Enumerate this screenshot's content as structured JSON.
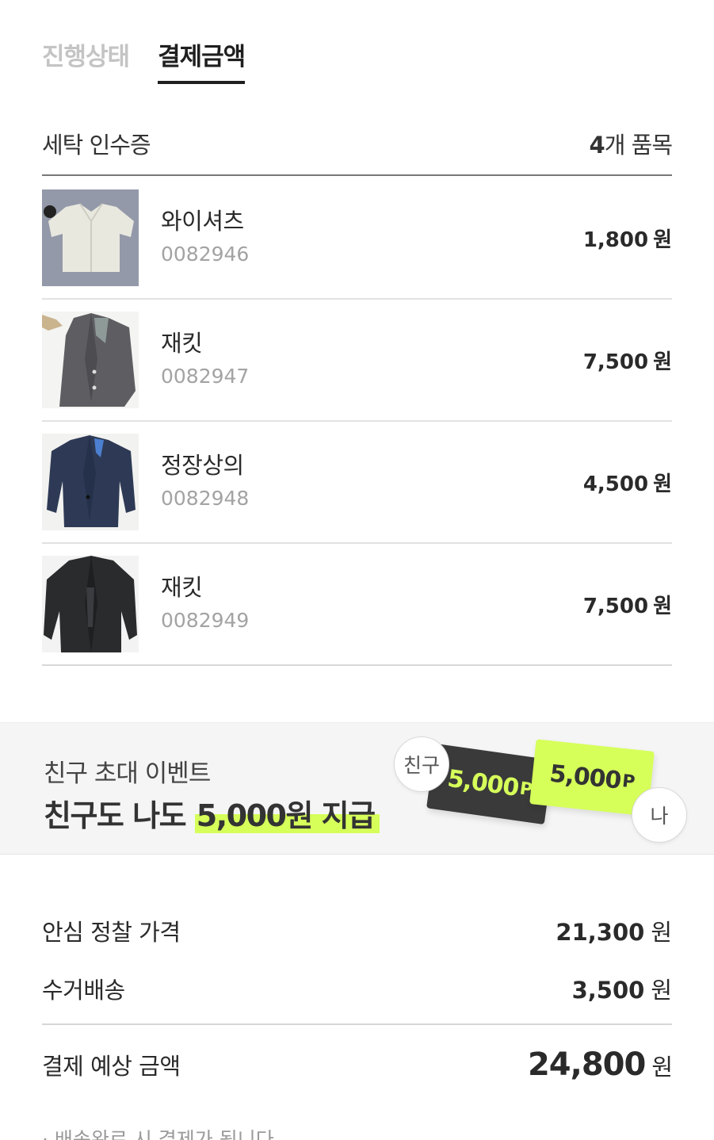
{
  "tabs": [
    {
      "label": "진행상태",
      "active": false
    },
    {
      "label": "결제금액",
      "active": true
    }
  ],
  "receipt": {
    "title": "세탁 인수증",
    "count_number": "4",
    "count_suffix": "개 품목"
  },
  "items": [
    {
      "name": "와이셔츠",
      "code": "0082946",
      "price": "1,800",
      "currency": "원",
      "thumb_icon": "dress-shirt-photo"
    },
    {
      "name": "재킷",
      "code": "0082947",
      "price": "7,500",
      "currency": "원",
      "thumb_icon": "gray-jacket-photo"
    },
    {
      "name": "정장상의",
      "code": "0082948",
      "price": "4,500",
      "currency": "원",
      "thumb_icon": "navy-suit-jacket-photo"
    },
    {
      "name": "재킷",
      "code": "0082949",
      "price": "7,500",
      "currency": "원",
      "thumb_icon": "black-jacket-photo"
    }
  ],
  "banner": {
    "subtitle": "친구 초대 이벤트",
    "title_prefix": "친구도 나도 ",
    "title_highlight": "5,000원 지급",
    "coupon_friend": "5,000",
    "coupon_me": "5,000",
    "coupon_unit": "P",
    "bubble_friend": "친구",
    "bubble_me": "나",
    "highlight_color": "#d6ff5a",
    "dark_coupon_color": "#3a3a3a"
  },
  "totals": {
    "rows": [
      {
        "label": "안심 정찰 가격",
        "value": "21,300",
        "currency": "원"
      },
      {
        "label": "수거배송",
        "value": "3,500",
        "currency": "원"
      }
    ],
    "grand_label": "결제 예상 금액",
    "grand_value": "24,800",
    "grand_currency": "원",
    "note": "· 배송완료 시 결제가 됩니다"
  }
}
